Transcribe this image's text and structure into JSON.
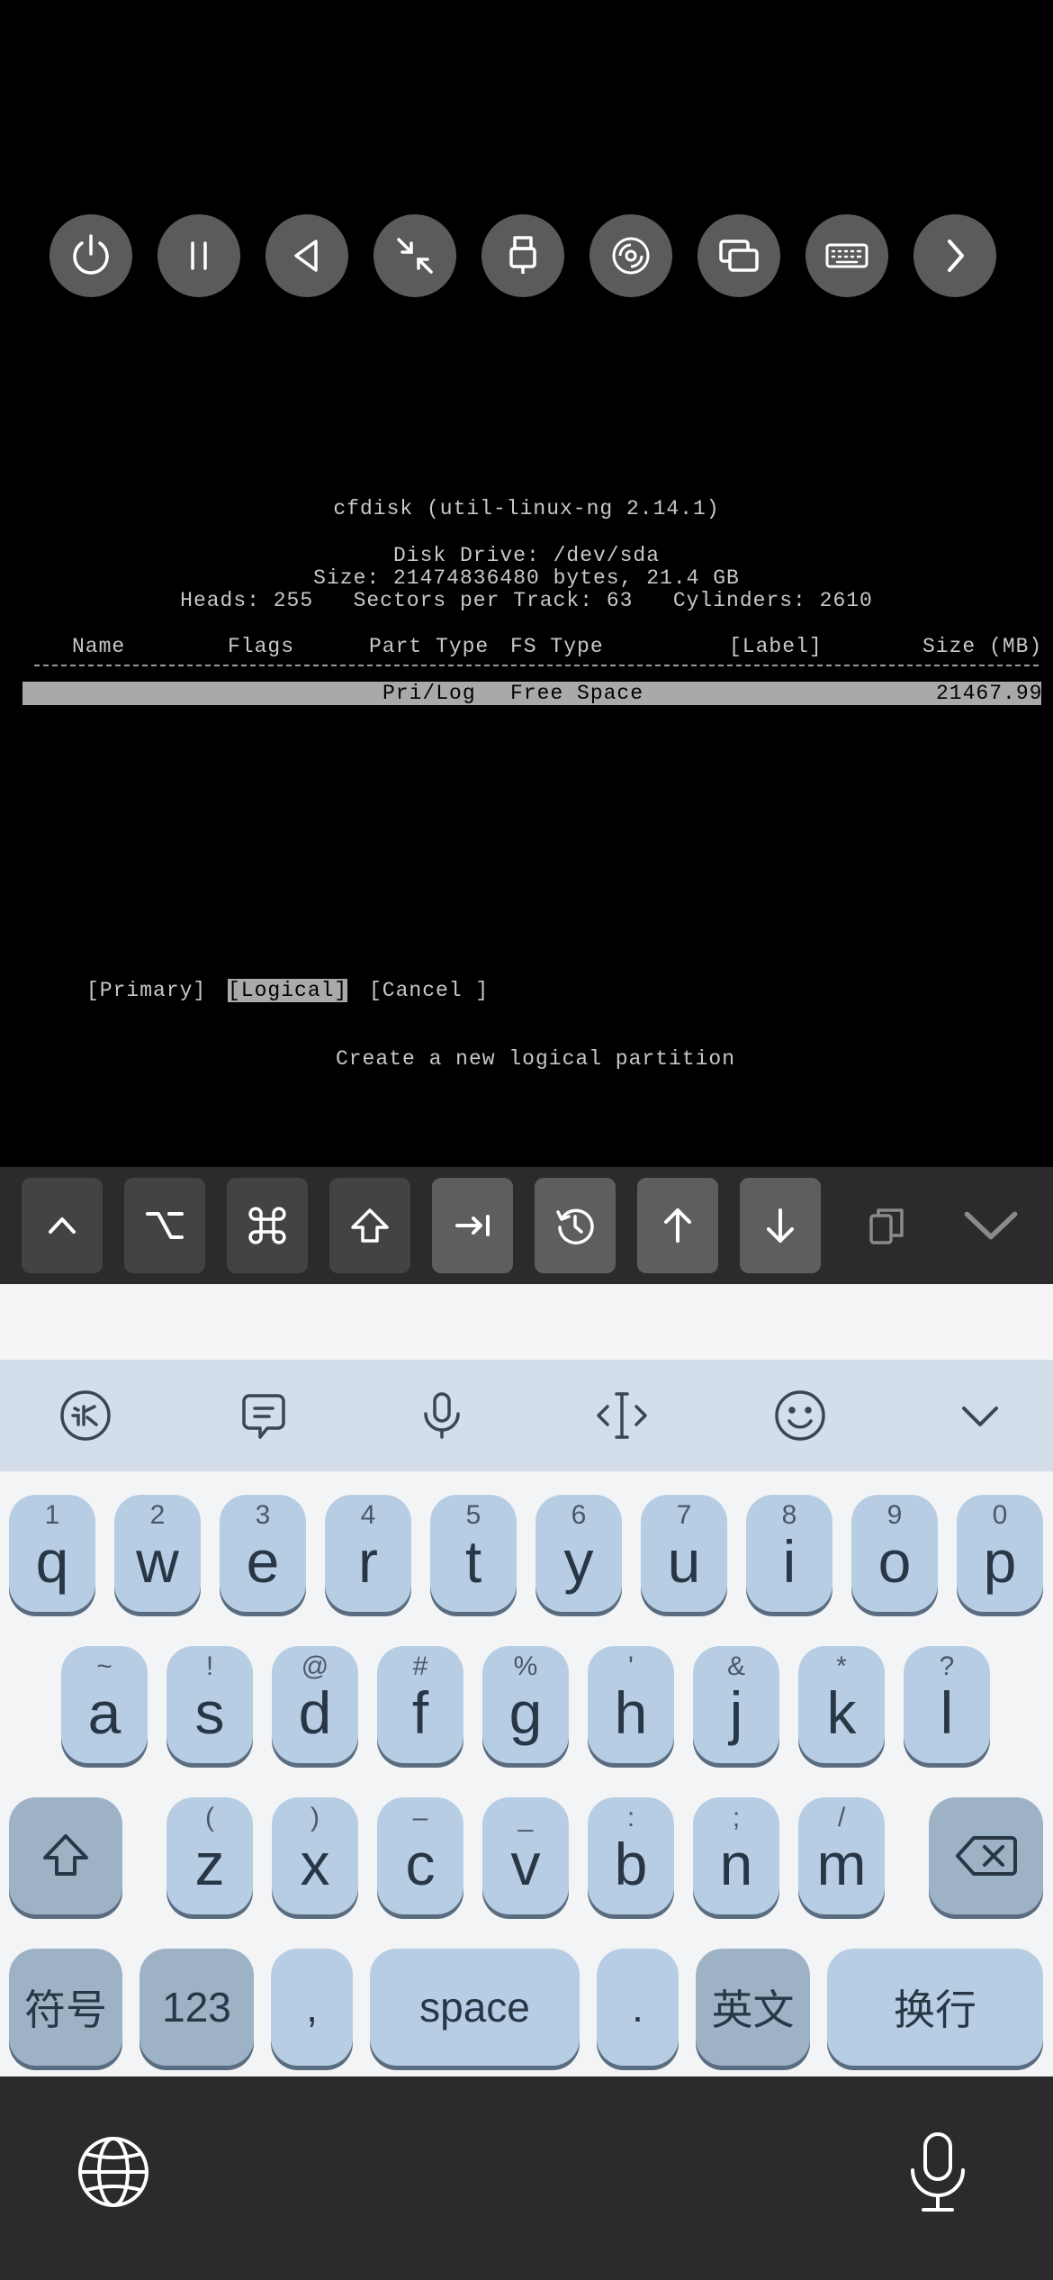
{
  "toolbar": {
    "buttons": [
      {
        "name": "power-icon"
      },
      {
        "name": "pause-icon"
      },
      {
        "name": "back-triangle-icon"
      },
      {
        "name": "shrink-arrows-icon"
      },
      {
        "name": "usb-icon"
      },
      {
        "name": "disc-icon"
      },
      {
        "name": "windows-icon"
      },
      {
        "name": "keyboard-icon"
      },
      {
        "name": "chevron-right-icon"
      }
    ]
  },
  "terminal": {
    "title": "cfdisk (util-linux-ng 2.14.1)",
    "disk_drive": "Disk Drive: /dev/sda",
    "size_line": "Size: 21474836480 bytes, 21.4 GB",
    "geometry_line": "Heads: 255   Sectors per Track: 63   Cylinders: 2610",
    "headers": {
      "name": "Name",
      "flags": "Flags",
      "part_type": "Part Type",
      "fs_type": "FS Type",
      "label": "[Label]",
      "size": "Size (MB)"
    },
    "row": {
      "part_type": "Pri/Log",
      "fs_type": "Free Space",
      "size": "21467.99"
    },
    "menu": {
      "primary": "[Primary]",
      "logical": "[Logical]",
      "cancel": "[Cancel ]"
    },
    "help_text": "Create a new logical partition"
  },
  "keybar": {
    "keys": [
      "ctrl-caret-icon",
      "option-icon",
      "command-icon",
      "shift-icon",
      "tab-icon",
      "history-icon",
      "arrow-up-icon",
      "arrow-down-icon",
      "paste-icon",
      "dismiss-chevron-icon"
    ]
  },
  "keyboard": {
    "row1": [
      {
        "hint": "1",
        "key": "q"
      },
      {
        "hint": "2",
        "key": "w"
      },
      {
        "hint": "3",
        "key": "e"
      },
      {
        "hint": "4",
        "key": "r"
      },
      {
        "hint": "5",
        "key": "t"
      },
      {
        "hint": "6",
        "key": "y"
      },
      {
        "hint": "7",
        "key": "u"
      },
      {
        "hint": "8",
        "key": "i"
      },
      {
        "hint": "9",
        "key": "o"
      },
      {
        "hint": "0",
        "key": "p"
      }
    ],
    "row2": [
      {
        "hint": "~",
        "key": "a"
      },
      {
        "hint": "!",
        "key": "s"
      },
      {
        "hint": "@",
        "key": "d"
      },
      {
        "hint": "#",
        "key": "f"
      },
      {
        "hint": "%",
        "key": "g"
      },
      {
        "hint": "'",
        "key": "h"
      },
      {
        "hint": "&",
        "key": "j"
      },
      {
        "hint": "*",
        "key": "k"
      },
      {
        "hint": "?",
        "key": "l"
      }
    ],
    "row3": [
      {
        "hint": "(",
        "key": "z"
      },
      {
        "hint": ")",
        "key": "x"
      },
      {
        "hint": "–",
        "key": "c"
      },
      {
        "hint": "_",
        "key": "v"
      },
      {
        "hint": ":",
        "key": "b"
      },
      {
        "hint": ";",
        "key": "n"
      },
      {
        "hint": "/",
        "key": "m"
      }
    ],
    "row4": {
      "symbols": "符号",
      "numbers": "123",
      "comma": ",",
      "space": "space",
      "period": ".",
      "lang": "英文",
      "enter": "换行"
    }
  }
}
